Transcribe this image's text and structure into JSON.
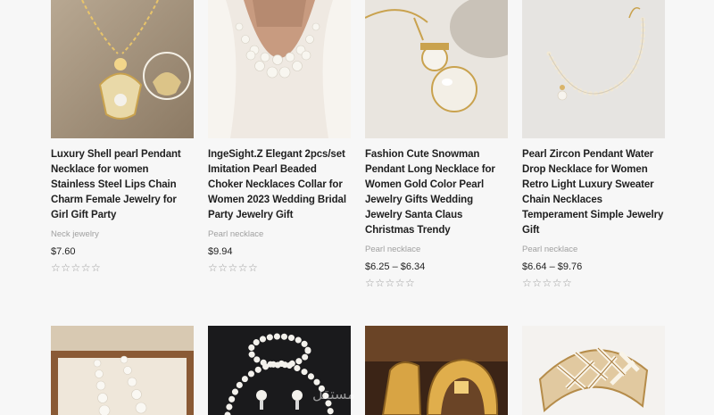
{
  "products": [
    {
      "title": "Luxury Shell pearl Pendant Necklace for women Stainless Steel Lips Chain Charm Female Jewelry for Girl Gift Party",
      "category": "Neck jewelry",
      "price": "$7.60",
      "rating_stars": "☆☆☆☆☆",
      "image": "gold-shell-pendant-necklace"
    },
    {
      "title": "IngeSight.Z Elegant 2pcs/set Imitation Pearl Beaded Choker Necklaces Collar for Women 2023 Wedding Bridal Party Jewelry Gift",
      "category": "Pearl necklace",
      "price": "$9.94",
      "rating_stars": "☆☆☆☆☆",
      "image": "layered-pearl-choker"
    },
    {
      "title": "Fashion Cute Snowman Pendant Long Necklace for Women Gold Color Pearl Jewelry Gifts Wedding Jewelry Santa Claus Christmas Trendy",
      "category": "Pearl necklace",
      "price": "$6.25 – $6.34",
      "rating_stars": "☆☆☆☆☆",
      "image": "snowman-pearl-pendant"
    },
    {
      "title": "Pearl Zircon Pendant Water Drop Necklace for Women Retro Light Luxury Sweater Chain Necklaces Temperament Simple Jewelry Gift",
      "category": "Pearl necklace",
      "price": "$6.64 – $9.76",
      "rating_stars": "☆☆☆☆☆",
      "image": "pearl-water-drop-necklace"
    }
  ],
  "row2_images": [
    "pearl-drop-earrings",
    "pearl-jewelry-set",
    "gold-hoop-earrings",
    "zircon-gold-ring"
  ],
  "watermark": "مستقل",
  "colors": {
    "page_bg": "#f7f7f7",
    "title": "#1f1f1f",
    "category": "#a0a0a0",
    "stars": "#9a9a9a"
  }
}
